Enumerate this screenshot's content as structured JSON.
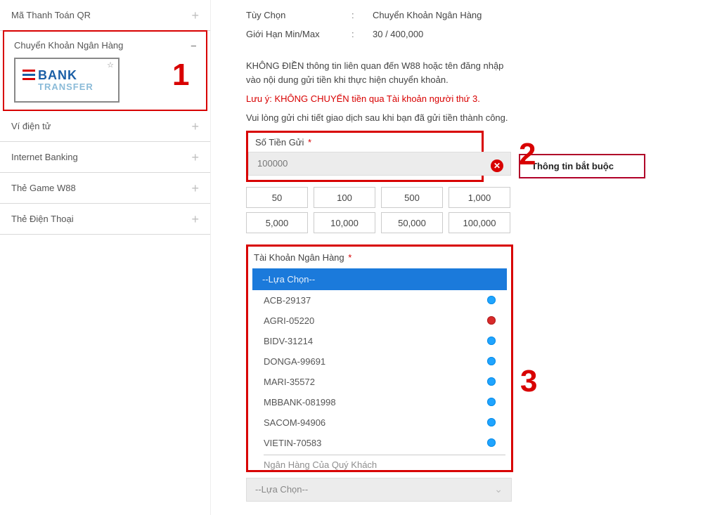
{
  "sidebar": {
    "items": [
      {
        "label": "Mã Thanh Toán QR"
      },
      {
        "label": "Chuyển Khoản Ngân Hàng"
      },
      {
        "label": "Ví điện tử"
      },
      {
        "label": "Internet Banking"
      },
      {
        "label": "Thẻ Game W88"
      },
      {
        "label": "Thẻ Điện Thoại"
      }
    ],
    "bank_logo": {
      "l1": "BANK",
      "l2": "TRANSFER"
    }
  },
  "info": {
    "opt_label": "Tùy Chọn",
    "opt_value": "Chuyển Khoản Ngân Hàng",
    "limit_label": "Giới Hạn Min/Max",
    "limit_value": "30 / 400,000"
  },
  "notes": {
    "n1": "KHÔNG ĐIỀN thông tin liên quan đến W88 hoặc tên đăng nhập vào nội dung gửi tiền khi thực hiện chuyển khoản.",
    "n2": "Lưu ý: KHÔNG CHUYỂN tiền qua Tài khoản người thứ 3.",
    "n3": "Vui lòng gửi chi tiết giao dịch sau khi bạn đã gửi tiền thành công."
  },
  "amount": {
    "label": "Số Tiền Gửi",
    "value": "100000",
    "error": "Thông tin bắt buộc",
    "quick": [
      "50",
      "100",
      "500",
      "1,000",
      "5,000",
      "10,000",
      "50,000",
      "100,000"
    ]
  },
  "account": {
    "label": "Tài Khoản Ngân Hàng",
    "selected": "--Lựa Chọn--",
    "options": [
      {
        "label": "ACB-29137",
        "status": "blue"
      },
      {
        "label": "AGRI-05220",
        "status": "red"
      },
      {
        "label": "BIDV-31214",
        "status": "blue"
      },
      {
        "label": "DONGA-99691",
        "status": "blue"
      },
      {
        "label": "MARI-35572",
        "status": "blue"
      },
      {
        "label": "MBBANK-081998",
        "status": "blue"
      },
      {
        "label": "SACOM-94906",
        "status": "blue"
      },
      {
        "label": "VIETIN-70583",
        "status": "blue"
      }
    ]
  },
  "cut_label": "Ngân Hàng Của Quý Khách",
  "select2": "--Lựa Chọn--",
  "nums": {
    "n1": "1",
    "n2": "2",
    "n3": "3"
  },
  "glyphs": {
    "plus": "+",
    "minus": "–",
    "x": "✕",
    "chev": "╲╱",
    "star": "☆",
    "colon": ":"
  }
}
